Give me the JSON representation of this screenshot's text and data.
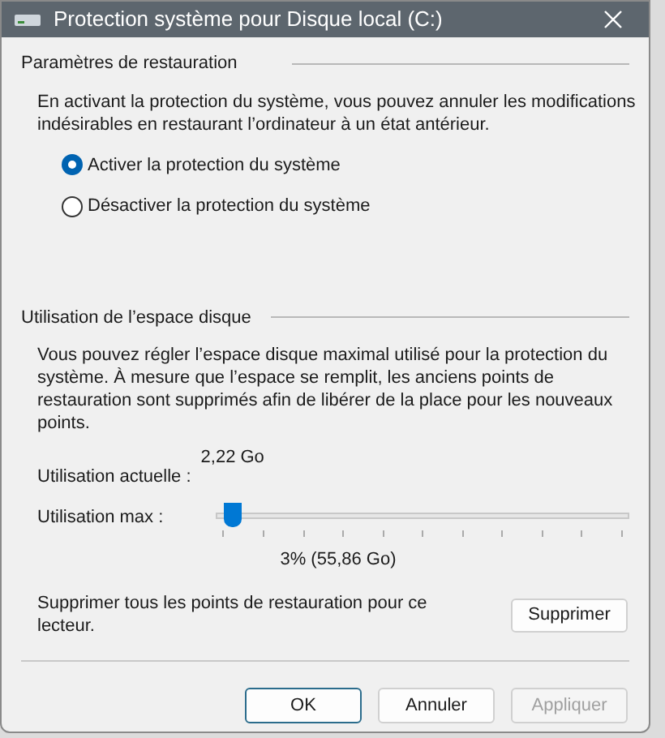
{
  "window": {
    "title": "Protection système pour Disque local (C:)"
  },
  "restore_settings": {
    "heading": "Paramètres de restauration",
    "description": "En activant la protection du système, vous pouvez annuler les modifications indésirables en restaurant l’ordinateur à un état antérieur.",
    "options": [
      {
        "label": "Activer la protection du système",
        "selected": true
      },
      {
        "label": "Désactiver la protection du système",
        "selected": false
      }
    ]
  },
  "disk_usage": {
    "heading": "Utilisation de l’espace disque",
    "description": "Vous pouvez régler l’espace disque maximal utilisé pour la protection du système. À mesure que l’espace se remplit, les anciens points de restauration sont supprimés afin de libérer de la place pour les nouveaux points.",
    "current_label": "Utilisation actuelle :",
    "current_value": "2,22 Go",
    "max_label": "Utilisation max :",
    "slider": {
      "level": 0.02
    },
    "max_reading": "3% (55,86 Go)",
    "delete_text": "Supprimer tous les points de restauration pour ce lecteur.",
    "delete_button": "Supprimer"
  },
  "buttons": [
    {
      "label": "OK",
      "kind": "default",
      "disabled": false
    },
    {
      "label": "Annuler",
      "kind": "normal",
      "disabled": false
    },
    {
      "label": "Appliquer",
      "kind": "normal",
      "disabled": true
    }
  ]
}
